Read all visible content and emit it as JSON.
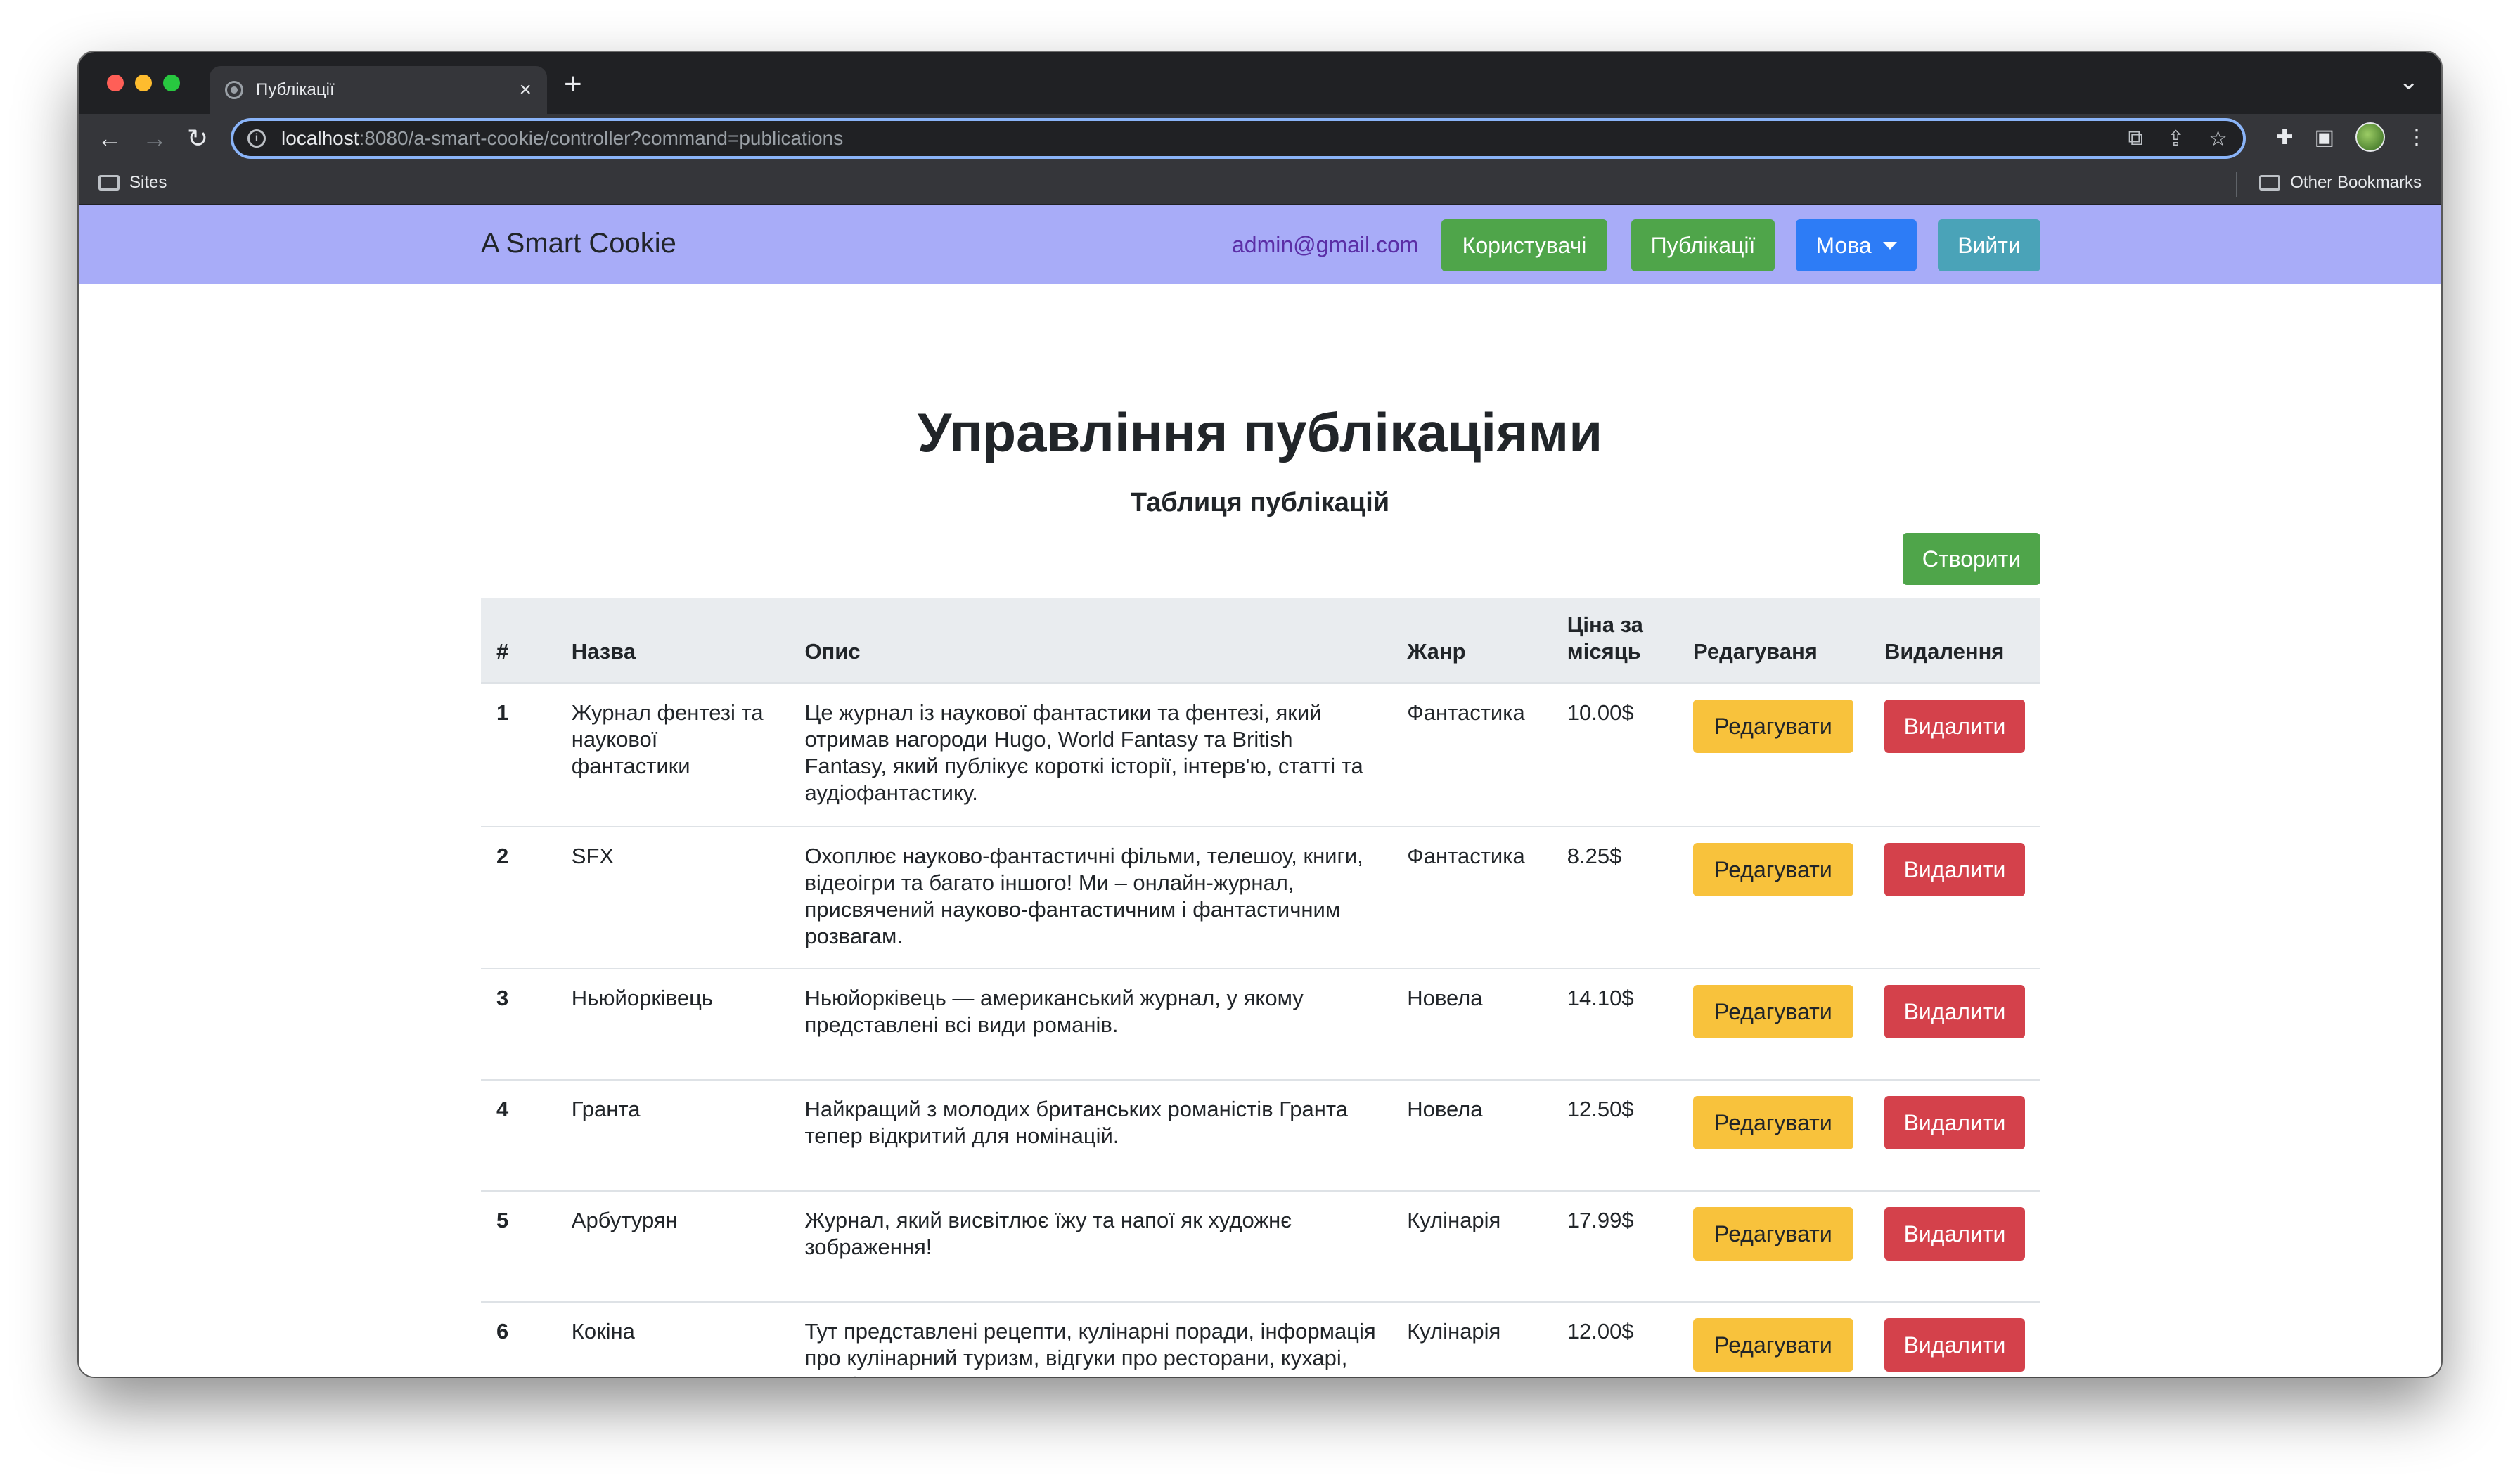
{
  "browser": {
    "tab_title": "Публікації",
    "url_host": "localhost",
    "url_rest": ":8080/a-smart-cookie/controller?command=publications",
    "bookmark_sites": "Sites",
    "bookmark_other": "Other Bookmarks"
  },
  "navbar": {
    "brand": "A Smart Cookie",
    "email": "admin@gmail.com",
    "users_label": "Користувачі",
    "publications_label": "Публікації",
    "language_label": "Мова",
    "logout_label": "Вийти"
  },
  "main": {
    "title": "Управління публікаціями",
    "subtitle": "Таблиця публікацій",
    "create_label": "Створити"
  },
  "table": {
    "headers": {
      "num": "#",
      "name": "Назва",
      "description": "Опис",
      "genre": "Жанр",
      "price": "Ціна за місяць",
      "edit": "Редагуваня",
      "delete": "Видалення"
    },
    "edit_label": "Редагувати",
    "delete_label": "Видалити",
    "rows": [
      {
        "num": "1",
        "name": "Журнал фентезі та наукової фантастики",
        "description": "Це журнал із наукової фантастики та фентезі, який отримав нагороди Hugo, World Fantasy та British Fantasy, який публікує короткі історії, інтерв'ю, статті та аудіофантастику.",
        "genre": "Фантастика",
        "price": "10.00$"
      },
      {
        "num": "2",
        "name": "SFX",
        "description": "Охоплює науково-фантастичні фільми, телешоу, книги, відеоігри та багато іншого! Ми – онлайн-журнал, присвячений науково-фантастичним і фантастичним розвагам.",
        "genre": "Фантастика",
        "price": "8.25$"
      },
      {
        "num": "3",
        "name": "Ньюйорківець",
        "description": "Ньюйорківець — американський журнал, у якому представлені всі види романів.",
        "genre": "Новела",
        "price": "14.10$"
      },
      {
        "num": "4",
        "name": "Гранта",
        "description": "Найкращий з молодих британських романістів Гранта тепер відкритий для номінацій.",
        "genre": "Новела",
        "price": "12.50$"
      },
      {
        "num": "5",
        "name": "Арбутурян",
        "description": "Журнал, який висвітлює їжу та напої як художнє зображення!",
        "genre": "Кулінарія",
        "price": "17.99$"
      },
      {
        "num": "6",
        "name": "Кокіна",
        "description": "Тут представлені рецепти, кулінарні поради, інформація про кулінарний туризм, відгуки про ресторани, кухарі, винні пари",
        "genre": "Кулінарія",
        "price": "12.00$"
      }
    ]
  }
}
